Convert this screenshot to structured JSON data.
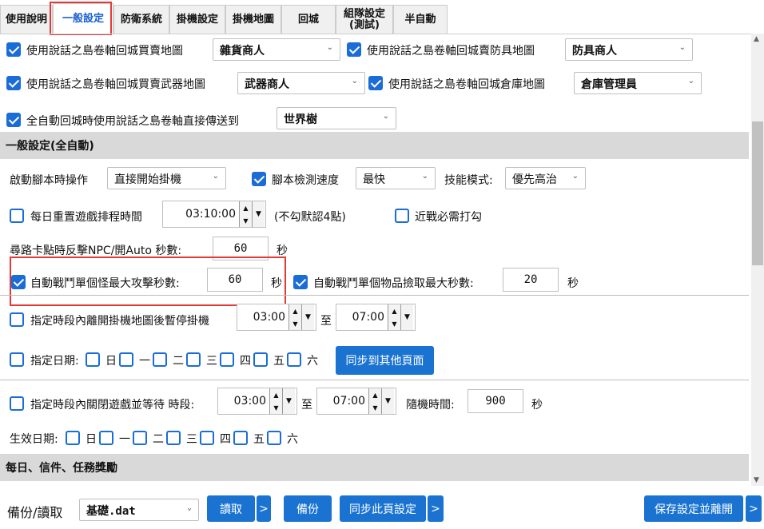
{
  "tabs": [
    {
      "label": "使用說明"
    },
    {
      "label": "一般設定"
    },
    {
      "label": "防衛系統"
    },
    {
      "label": "掛機設定"
    },
    {
      "label": "掛機地圖"
    },
    {
      "label": "回城"
    },
    {
      "label": "組隊設定\n(測試)"
    },
    {
      "label": "半自動"
    }
  ],
  "active_tab": "一般設定",
  "accent_color": "#1a73d1",
  "rows": {
    "grocery_label": "使用說話之島卷軸回城買賣地圖",
    "grocery_value": "雜貨商人",
    "armor_label": "使用說話之島卷軸回城賣防具地圖",
    "armor_value": "防具商人",
    "weapon_label": "使用說話之島卷軸回城買賣武器地圖",
    "weapon_value": "武器商人",
    "warehouse_label": "使用說話之島卷軸回城倉庫地圖",
    "warehouse_value": "倉庫管理員",
    "teleport_label": "全自動回城時使用說話之島卷軸直接傳送到",
    "teleport_value": "世界樹"
  },
  "section1": "一般設定(全自動)",
  "startup": {
    "label": "啟動腳本時操作",
    "value": "直接開始掛機",
    "speed_label": "腳本檢測速度",
    "speed_value": "最快",
    "skill_label": "技能模式:",
    "skill_value": "優先高治"
  },
  "reset": {
    "label": "每日重置遊戲排程時間",
    "time": "03:10:00",
    "note": "(不勾默認4點)",
    "melee_label": "近戰必需打勾"
  },
  "stuck": {
    "label": "尋路卡點時反擊NPC/開Auto 秒數:",
    "value": "60",
    "unit": "秒"
  },
  "auto_battle": {
    "label": "自動戰鬥單個怪最大攻擊秒數:",
    "value": "60",
    "unit": "秒",
    "pick_label": "自動戰鬥單個物品撿取最大秒數:",
    "pick_value": "20",
    "pick_unit": "秒"
  },
  "pause": {
    "label": "指定時段內離開掛機地圖後暫停掛機",
    "from": "03:00",
    "to_label": "至",
    "to": "07:00"
  },
  "days1": {
    "label": "指定日期:",
    "days": [
      "日",
      "一",
      "二",
      "三",
      "四",
      "五",
      "六"
    ],
    "sync": "同步到其他頁面"
  },
  "close": {
    "label": "指定時段內關閉遊戲並等待 時段:",
    "from": "03:00",
    "to_label": "至",
    "to": "07:00",
    "rand_label": "隨機時間:",
    "rand_value": "900",
    "unit": "秒"
  },
  "days2": {
    "label": "生效日期:",
    "days": [
      "日",
      "一",
      "二",
      "三",
      "四",
      "五",
      "六"
    ]
  },
  "section2": "每日、信件、任務獎勵",
  "bottom": {
    "backup_label": "備份/讀取",
    "file": "基礎.dat",
    "read": "讀取",
    "more": ">",
    "backup": "備份",
    "sync_page": "同步此頁設定",
    "save": "保存設定並離開"
  }
}
